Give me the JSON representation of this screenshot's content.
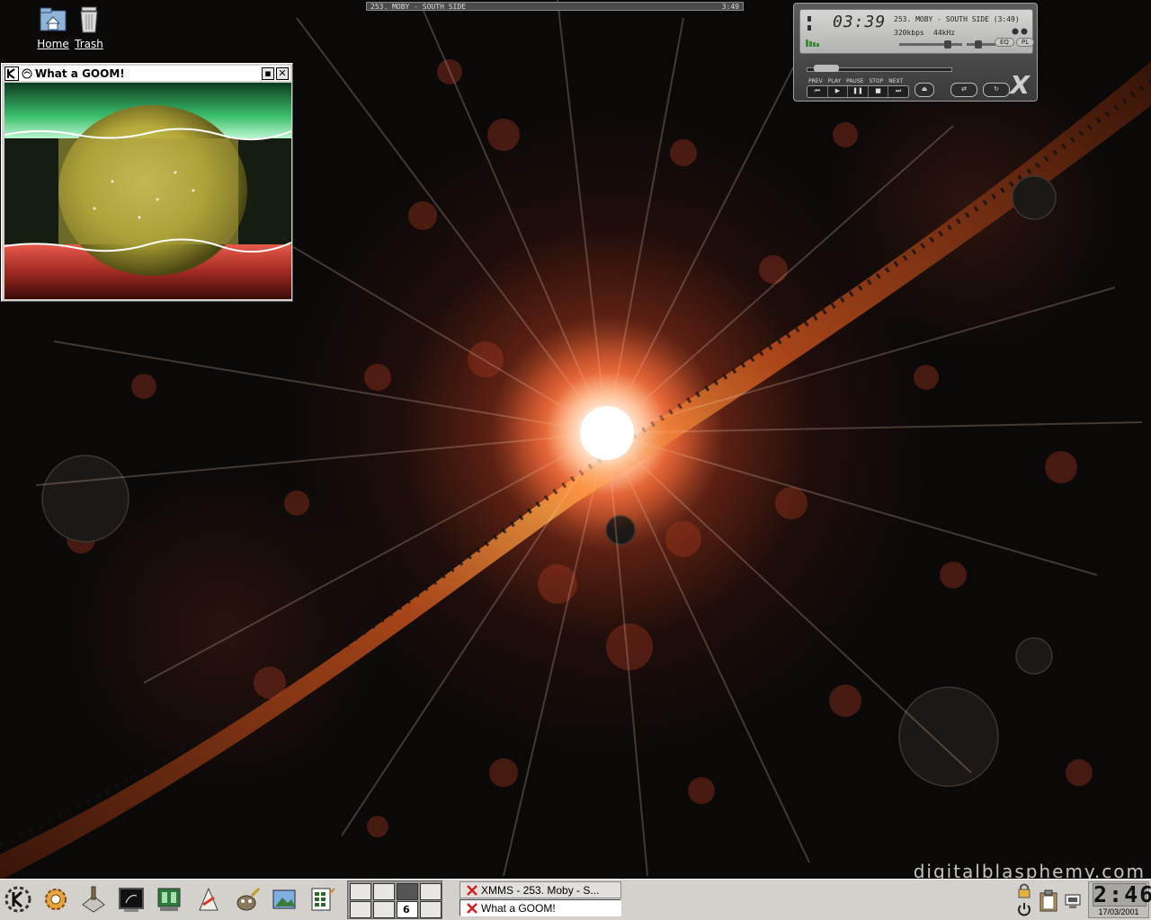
{
  "desktop": {
    "icons": [
      {
        "label": "Home",
        "icon": "home-folder-icon"
      },
      {
        "label": "Trash",
        "icon": "trash-icon"
      }
    ],
    "watermark": "digitalblasphemy.com",
    "wallpaper_accent": "#ff8040"
  },
  "goom_window": {
    "title": "What a GOOM!",
    "buttons": {
      "maximize": "▪",
      "close": "✕"
    }
  },
  "xmms": {
    "playlist_title": "253. MOBY - SOUTH SIDE",
    "playlist_time": "3:49",
    "time": "03:39",
    "song": "253. MOBY - SOUTH SIDE (3:49)",
    "bitrate": "320kbps",
    "frequency": "44kHz",
    "eq_label": "EQ",
    "pl_label": "PL",
    "control_labels": [
      "PREV",
      "PLAY",
      "PAUSE",
      "STOP",
      "NEXT"
    ],
    "logo": "X"
  },
  "taskbar": {
    "apps": [
      {
        "name": "kde-menu-icon"
      },
      {
        "name": "control-center-icon"
      },
      {
        "name": "settings-icon"
      },
      {
        "name": "terminal-icon"
      },
      {
        "name": "text-editor-icon"
      },
      {
        "name": "graphics-tool-icon"
      },
      {
        "name": "gimp-icon"
      },
      {
        "name": "image-viewer-icon"
      },
      {
        "name": "office-calc-icon"
      }
    ],
    "pager": {
      "active_desktop": 1,
      "calendar_day": "6"
    },
    "tasks": [
      {
        "label": "XMMS - 253. Moby - S...",
        "active": false
      },
      {
        "label": "What a GOOM!",
        "active": true
      }
    ],
    "clock": {
      "time": "2:46",
      "date": "17/03/2001"
    }
  }
}
